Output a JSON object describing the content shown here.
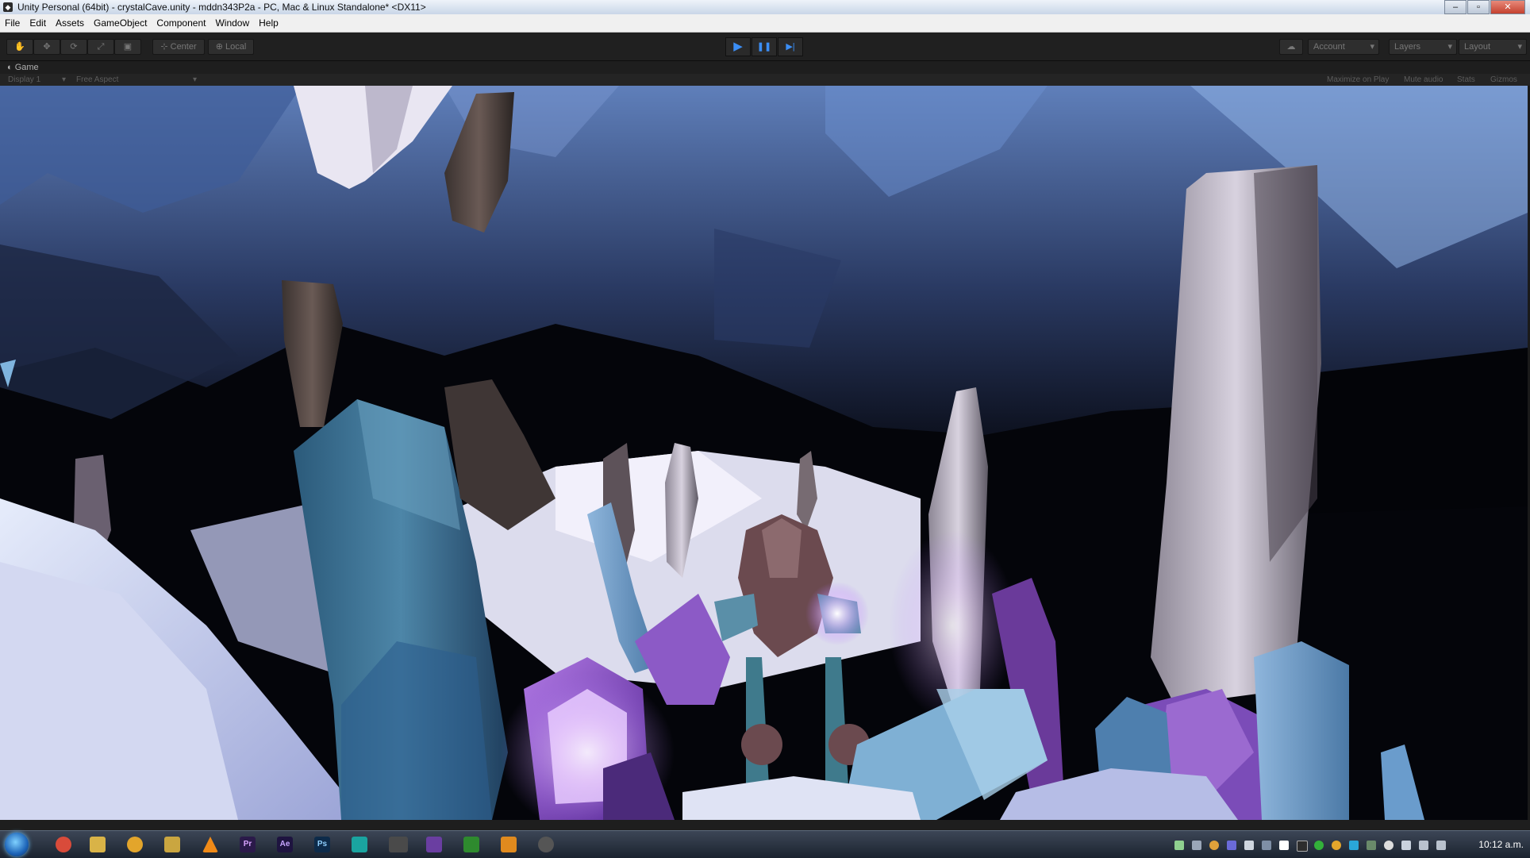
{
  "window": {
    "title": "Unity Personal (64bit) - crystalCave.unity - mddn343P2a - PC, Mac & Linux Standalone* <DX11>",
    "controls": {
      "minimize": "–",
      "maximize": "▫",
      "close": "✕"
    }
  },
  "menu": [
    "File",
    "Edit",
    "Assets",
    "GameObject",
    "Component",
    "Window",
    "Help"
  ],
  "toolbar": {
    "tools": [
      "hand-tool",
      "move-tool",
      "rotate-tool",
      "scale-tool",
      "rect-tool"
    ],
    "pivot_label": "Center",
    "handle_label": "Local",
    "play": "▶",
    "pause": "❚❚",
    "step": "▶|",
    "account_label": "Account",
    "layers_label": "Layers",
    "layout_label": "Layout"
  },
  "game_tab": {
    "label": "Game",
    "display": "Display 1",
    "aspect": "Free Aspect",
    "options": [
      "Maximize on Play",
      "Mute audio",
      "Stats",
      "Gizmos"
    ]
  },
  "taskbar": {
    "apps": [
      {
        "name": "chrome",
        "label": "",
        "color": "#d94b3a"
      },
      {
        "name": "explorer",
        "label": "",
        "color": "#d9b347"
      },
      {
        "name": "messenger",
        "label": "",
        "color": "#e3a52b"
      },
      {
        "name": "app",
        "label": "",
        "color": "#caa640"
      },
      {
        "name": "vlc",
        "label": "",
        "color": "#f08a17"
      },
      {
        "name": "premiere",
        "label": "Pr",
        "color": "#2b1a4a"
      },
      {
        "name": "after-effects",
        "label": "Ae",
        "color": "#1e1440"
      },
      {
        "name": "photoshop",
        "label": "Ps",
        "color": "#0d2b4a"
      },
      {
        "name": "app",
        "label": "",
        "color": "#1aa4a0"
      },
      {
        "name": "unity",
        "label": "",
        "color": "#4a4a4a"
      },
      {
        "name": "visual-studio",
        "label": "",
        "color": "#6a3ea1"
      },
      {
        "name": "app",
        "label": "",
        "color": "#2e8a2e"
      },
      {
        "name": "app",
        "label": "",
        "color": "#e08a1e"
      },
      {
        "name": "unity-editor",
        "label": "",
        "color": "#555555"
      }
    ],
    "clock": "10:12 a.m."
  }
}
